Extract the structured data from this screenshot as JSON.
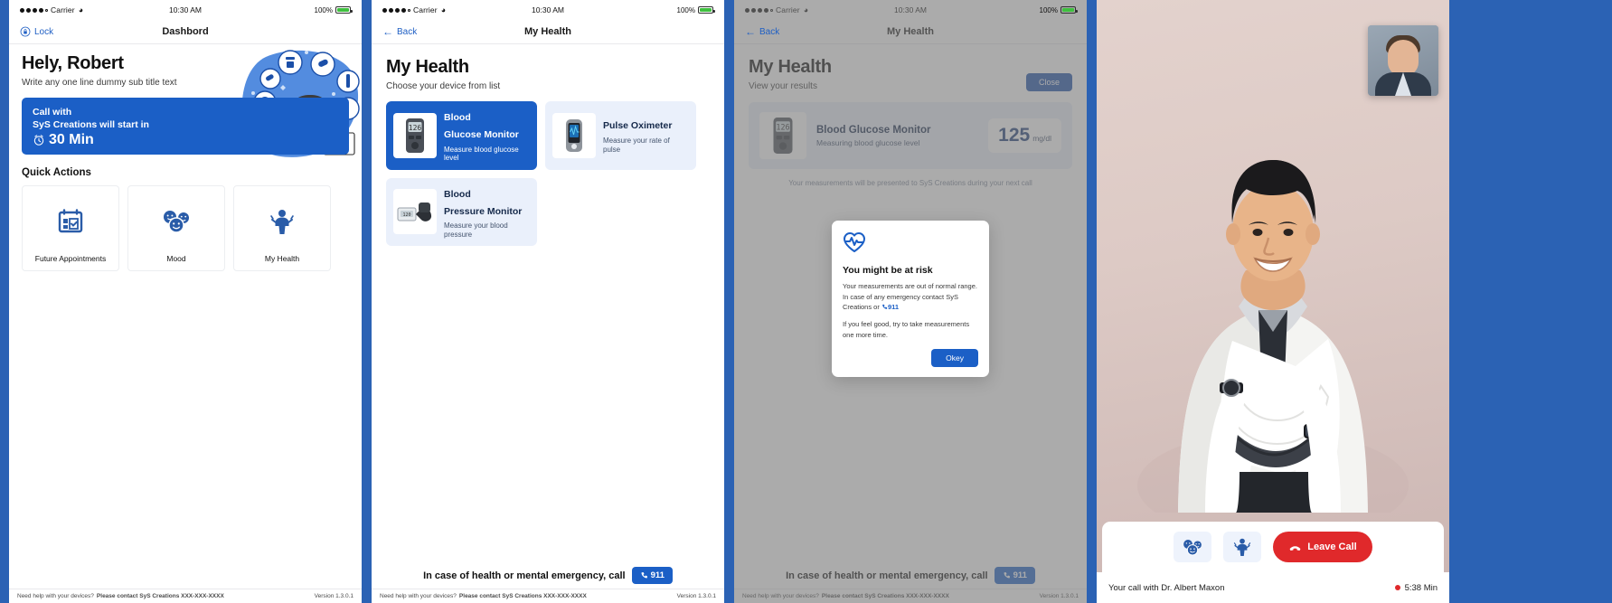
{
  "colors": {
    "brand_blue": "#1b5fc6",
    "dark_blue": "#1b4fa8",
    "board_bg": "#2b62b4",
    "light_blue_card": "#eaf0fb",
    "danger_red": "#e0292b",
    "battery_green": "#3ec03e"
  },
  "status_bar": {
    "carrier": "Carrier",
    "time": "10:30 AM",
    "battery_text": "100%",
    "wifi_icon": "wifi-icon",
    "signal_icon": "signal-dots-icon",
    "battery_icon": "battery-icon"
  },
  "footer_bar": {
    "help_prefix": "Need help with your devices?",
    "help_bold": "Please contact SyS Creations XXX-XXX-XXXX",
    "version": "Version 1.3.0.1"
  },
  "emergency": {
    "text": "In case of health or mental emergency, call",
    "button_label": "911",
    "phone_icon": "phone-icon"
  },
  "screen1": {
    "nav": {
      "left_label": "Lock",
      "left_icon": "lock-icon",
      "title": "Dashbord"
    },
    "greeting": "Hely, Robert",
    "subtitle": "Write any one line dummy sub title text",
    "call_card": {
      "line1": "Call with",
      "line2": "SyS Creations will start in",
      "time_remaining": "30 Min",
      "clock_icon": "alarm-clock-icon"
    },
    "quick_actions_title": "Quick Actions",
    "quick_actions": [
      {
        "label": "Future Appointments",
        "icon": "calendar-check-icon"
      },
      {
        "label": "Mood",
        "icon": "mood-faces-icon"
      },
      {
        "label": "My Health",
        "icon": "health-person-icon"
      }
    ],
    "illustration_icon": "doctor-illustration"
  },
  "screen2": {
    "nav": {
      "left_label": "Back",
      "left_icon": "back-arrow-icon",
      "title": "My Health"
    },
    "heading": "My Health",
    "subheading": "Choose your device from list",
    "devices": [
      {
        "name_line1": "Blood",
        "name_line2": "Glucose Monitor",
        "description": "Measure blood glucose level",
        "icon": "glucose-meter-icon",
        "selected": true
      },
      {
        "name_line1": "Pulse Oximeter",
        "name_line2": "",
        "description": "Measure your rate of pulse",
        "icon": "pulse-oximeter-icon",
        "selected": false
      },
      {
        "name_line1": "Blood",
        "name_line2": "Pressure Monitor",
        "description": "Measure your blood pressure",
        "icon": "bp-monitor-icon",
        "selected": false
      }
    ]
  },
  "screen3": {
    "nav": {
      "left_label": "Back",
      "left_icon": "back-arrow-icon",
      "title": "My Health"
    },
    "heading": "My Health",
    "subheading": "View your results",
    "close_label": "Close",
    "result": {
      "device_name": "Blood Glucose Monitor",
      "device_status": "Measuring blood glucose level",
      "value": "125",
      "unit": "mg/dl",
      "icon": "glucose-meter-icon"
    },
    "note": "Your measurements will be presented to SyS Creations during your next call",
    "modal": {
      "icon": "heart-pulse-icon",
      "title": "You might be at risk",
      "paragraph1_a": "Your measurements are out of normal range. In case of any emergency contact SyS Creations or",
      "paragraph1_phone": "911",
      "phone_icon": "phone-icon",
      "paragraph2": "If you feel good, try to take measurements one more time.",
      "ok_label": "Okey"
    }
  },
  "screen4": {
    "pip_label": "self-view-thumbnail",
    "main_video_label": "remote-doctor-video",
    "controls": [
      {
        "name": "mood-button",
        "icon": "mood-faces-icon"
      },
      {
        "name": "my-health-button",
        "icon": "health-person-icon"
      }
    ],
    "leave_call_label": "Leave Call",
    "leave_call_icon": "phone-hangup-icon",
    "call_status": "Your call with Dr. Albert Maxon",
    "call_duration": "5:38 Min",
    "recording_icon": "record-dot-icon"
  }
}
